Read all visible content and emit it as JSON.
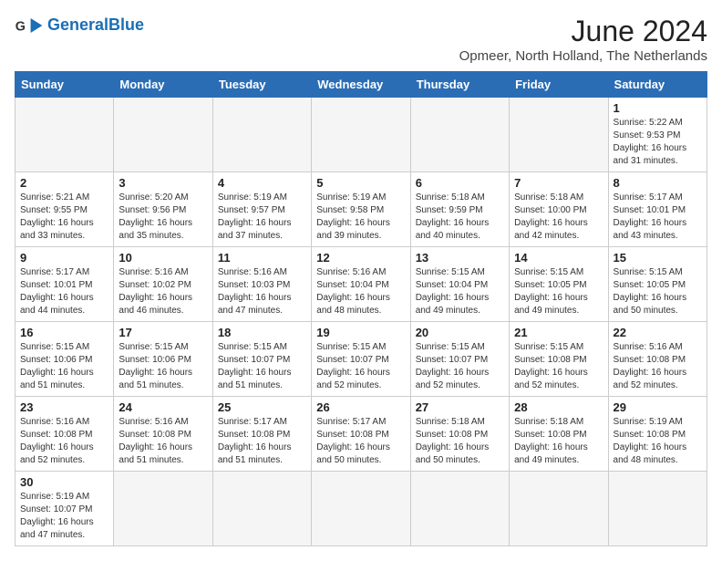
{
  "header": {
    "logo_general": "General",
    "logo_blue": "Blue",
    "month_year": "June 2024",
    "location": "Opmeer, North Holland, The Netherlands"
  },
  "weekdays": [
    "Sunday",
    "Monday",
    "Tuesday",
    "Wednesday",
    "Thursday",
    "Friday",
    "Saturday"
  ],
  "weeks": [
    [
      {
        "day": null,
        "info": null
      },
      {
        "day": null,
        "info": null
      },
      {
        "day": null,
        "info": null
      },
      {
        "day": null,
        "info": null
      },
      {
        "day": null,
        "info": null
      },
      {
        "day": null,
        "info": null
      },
      {
        "day": "1",
        "info": "Sunrise: 5:22 AM\nSunset: 9:53 PM\nDaylight: 16 hours and 31 minutes."
      }
    ],
    [
      {
        "day": "2",
        "info": "Sunrise: 5:21 AM\nSunset: 9:55 PM\nDaylight: 16 hours and 33 minutes."
      },
      {
        "day": "3",
        "info": "Sunrise: 5:20 AM\nSunset: 9:56 PM\nDaylight: 16 hours and 35 minutes."
      },
      {
        "day": "4",
        "info": "Sunrise: 5:19 AM\nSunset: 9:57 PM\nDaylight: 16 hours and 37 minutes."
      },
      {
        "day": "5",
        "info": "Sunrise: 5:19 AM\nSunset: 9:58 PM\nDaylight: 16 hours and 39 minutes."
      },
      {
        "day": "6",
        "info": "Sunrise: 5:18 AM\nSunset: 9:59 PM\nDaylight: 16 hours and 40 minutes."
      },
      {
        "day": "7",
        "info": "Sunrise: 5:18 AM\nSunset: 10:00 PM\nDaylight: 16 hours and 42 minutes."
      },
      {
        "day": "8",
        "info": "Sunrise: 5:17 AM\nSunset: 10:01 PM\nDaylight: 16 hours and 43 minutes."
      }
    ],
    [
      {
        "day": "9",
        "info": "Sunrise: 5:17 AM\nSunset: 10:01 PM\nDaylight: 16 hours and 44 minutes."
      },
      {
        "day": "10",
        "info": "Sunrise: 5:16 AM\nSunset: 10:02 PM\nDaylight: 16 hours and 46 minutes."
      },
      {
        "day": "11",
        "info": "Sunrise: 5:16 AM\nSunset: 10:03 PM\nDaylight: 16 hours and 47 minutes."
      },
      {
        "day": "12",
        "info": "Sunrise: 5:16 AM\nSunset: 10:04 PM\nDaylight: 16 hours and 48 minutes."
      },
      {
        "day": "13",
        "info": "Sunrise: 5:15 AM\nSunset: 10:04 PM\nDaylight: 16 hours and 49 minutes."
      },
      {
        "day": "14",
        "info": "Sunrise: 5:15 AM\nSunset: 10:05 PM\nDaylight: 16 hours and 49 minutes."
      },
      {
        "day": "15",
        "info": "Sunrise: 5:15 AM\nSunset: 10:05 PM\nDaylight: 16 hours and 50 minutes."
      }
    ],
    [
      {
        "day": "16",
        "info": "Sunrise: 5:15 AM\nSunset: 10:06 PM\nDaylight: 16 hours and 51 minutes."
      },
      {
        "day": "17",
        "info": "Sunrise: 5:15 AM\nSunset: 10:06 PM\nDaylight: 16 hours and 51 minutes."
      },
      {
        "day": "18",
        "info": "Sunrise: 5:15 AM\nSunset: 10:07 PM\nDaylight: 16 hours and 51 minutes."
      },
      {
        "day": "19",
        "info": "Sunrise: 5:15 AM\nSunset: 10:07 PM\nDaylight: 16 hours and 52 minutes."
      },
      {
        "day": "20",
        "info": "Sunrise: 5:15 AM\nSunset: 10:07 PM\nDaylight: 16 hours and 52 minutes."
      },
      {
        "day": "21",
        "info": "Sunrise: 5:15 AM\nSunset: 10:08 PM\nDaylight: 16 hours and 52 minutes."
      },
      {
        "day": "22",
        "info": "Sunrise: 5:16 AM\nSunset: 10:08 PM\nDaylight: 16 hours and 52 minutes."
      }
    ],
    [
      {
        "day": "23",
        "info": "Sunrise: 5:16 AM\nSunset: 10:08 PM\nDaylight: 16 hours and 52 minutes."
      },
      {
        "day": "24",
        "info": "Sunrise: 5:16 AM\nSunset: 10:08 PM\nDaylight: 16 hours and 51 minutes."
      },
      {
        "day": "25",
        "info": "Sunrise: 5:17 AM\nSunset: 10:08 PM\nDaylight: 16 hours and 51 minutes."
      },
      {
        "day": "26",
        "info": "Sunrise: 5:17 AM\nSunset: 10:08 PM\nDaylight: 16 hours and 50 minutes."
      },
      {
        "day": "27",
        "info": "Sunrise: 5:18 AM\nSunset: 10:08 PM\nDaylight: 16 hours and 50 minutes."
      },
      {
        "day": "28",
        "info": "Sunrise: 5:18 AM\nSunset: 10:08 PM\nDaylight: 16 hours and 49 minutes."
      },
      {
        "day": "29",
        "info": "Sunrise: 5:19 AM\nSunset: 10:08 PM\nDaylight: 16 hours and 48 minutes."
      }
    ],
    [
      {
        "day": "30",
        "info": "Sunrise: 5:19 AM\nSunset: 10:07 PM\nDaylight: 16 hours and 47 minutes."
      },
      {
        "day": null,
        "info": null
      },
      {
        "day": null,
        "info": null
      },
      {
        "day": null,
        "info": null
      },
      {
        "day": null,
        "info": null
      },
      {
        "day": null,
        "info": null
      },
      {
        "day": null,
        "info": null
      }
    ]
  ]
}
